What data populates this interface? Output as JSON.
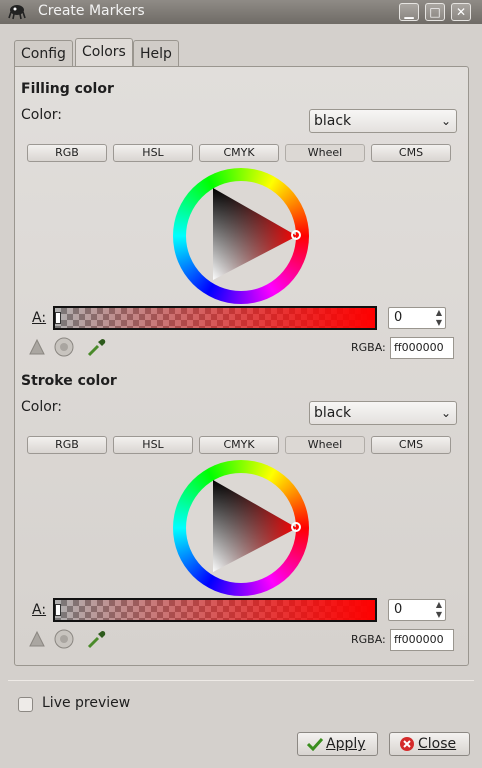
{
  "window": {
    "title": "Create Markers"
  },
  "tabs": [
    {
      "label": "Config",
      "active": false
    },
    {
      "label": "Colors",
      "active": true
    },
    {
      "label": "Help",
      "active": false
    }
  ],
  "filling": {
    "title": "Filling color",
    "color_label": "Color:",
    "color_value": "black",
    "modes": [
      "RGB",
      "HSL",
      "CMYK",
      "Wheel",
      "CMS"
    ],
    "active_mode": "Wheel",
    "alpha_label": "A:",
    "alpha_value": "0",
    "rgba_label": "RGBA:",
    "rgba_value": "ff000000"
  },
  "stroke": {
    "title": "Stroke color",
    "color_label": "Color:",
    "color_value": "black",
    "modes": [
      "RGB",
      "HSL",
      "CMYK",
      "Wheel",
      "CMS"
    ],
    "active_mode": "Wheel",
    "alpha_label": "A:",
    "alpha_value": "0",
    "rgba_label": "RGBA:",
    "rgba_value": "ff000000"
  },
  "live_preview": {
    "label": "Live preview",
    "checked": false
  },
  "buttons": {
    "apply": "Apply",
    "close": "Close"
  },
  "colors": {
    "accent_hue": "#ff0000",
    "window_bg": "#d4d0cc"
  },
  "icons": [
    "app-icon",
    "minimize-icon",
    "maximize-icon",
    "close-icon",
    "color-managed-icon",
    "out-of-gamut-icon",
    "eyedropper-icon",
    "checkmark-icon",
    "close-circle-icon"
  ]
}
